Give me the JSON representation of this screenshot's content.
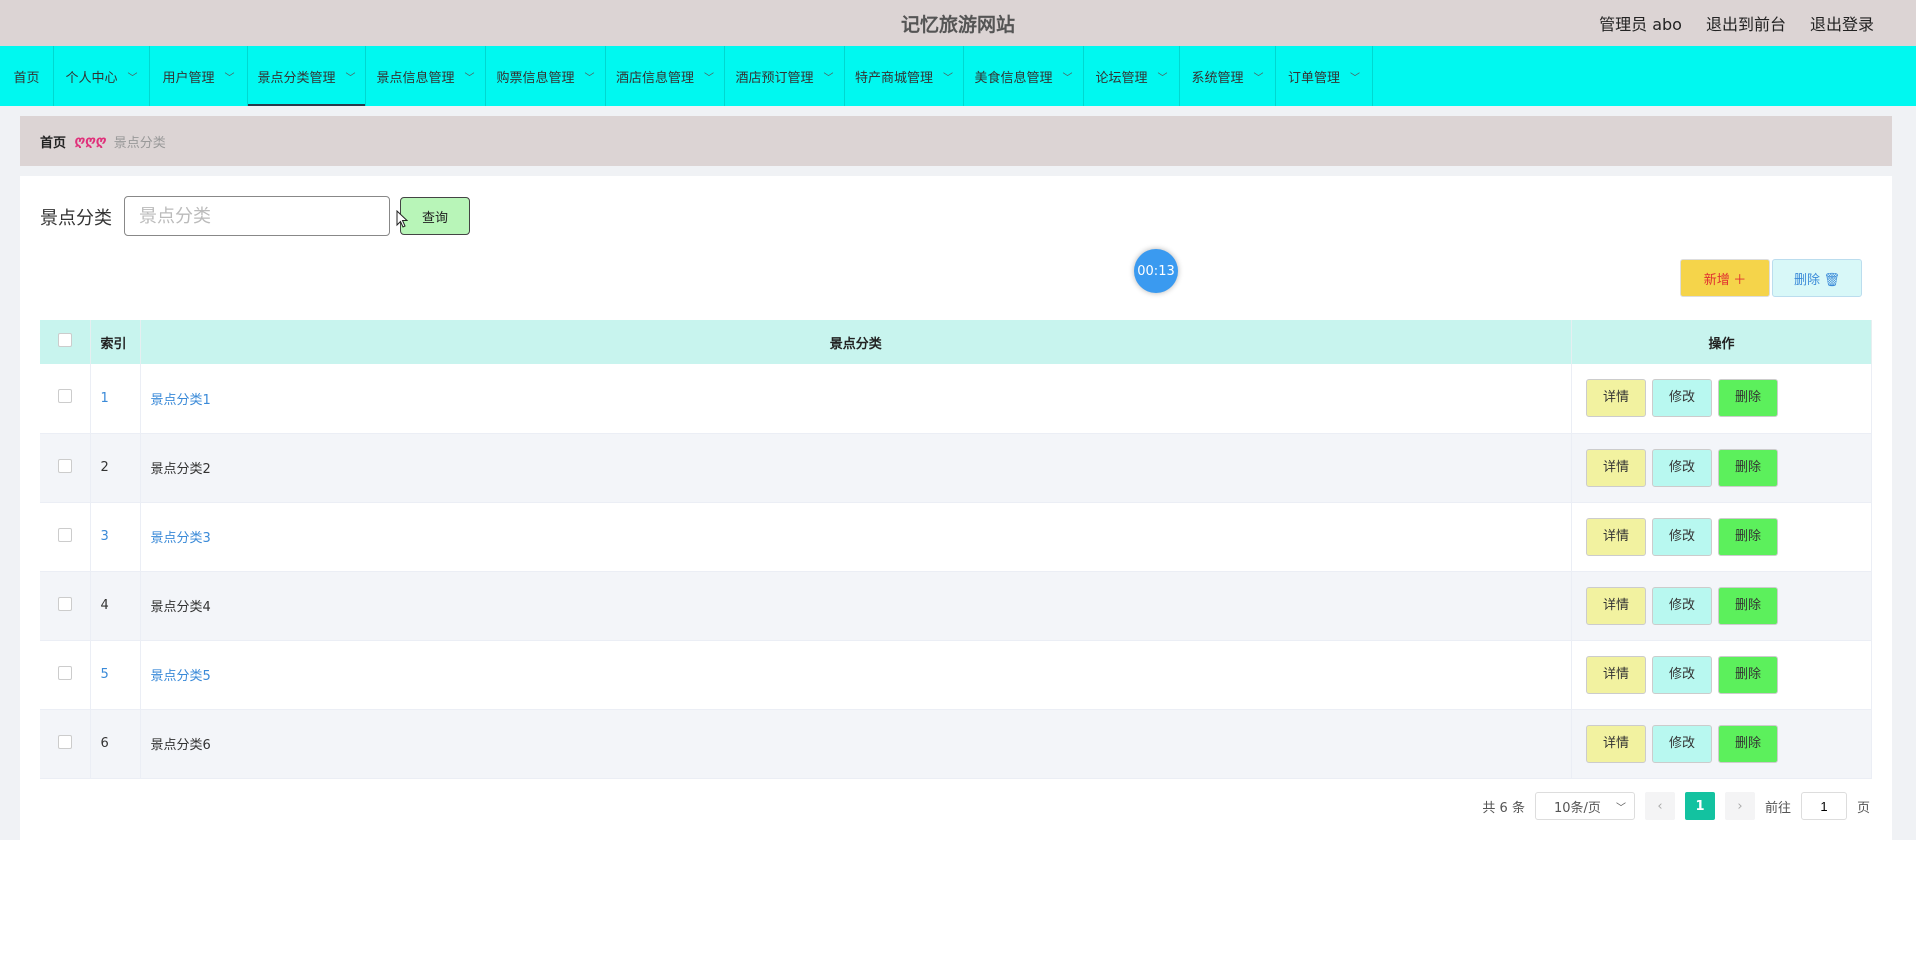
{
  "header": {
    "title": "记忆旅游网站",
    "user_label": "管理员 abo",
    "back_to_front": "退出到前台",
    "logout": "退出登录"
  },
  "nav": {
    "items": [
      {
        "label": "首页",
        "has_dropdown": false
      },
      {
        "label": "个人中心",
        "has_dropdown": true
      },
      {
        "label": "用户管理",
        "has_dropdown": true
      },
      {
        "label": "景点分类管理",
        "has_dropdown": true,
        "active": true
      },
      {
        "label": "景点信息管理",
        "has_dropdown": true
      },
      {
        "label": "购票信息管理",
        "has_dropdown": true
      },
      {
        "label": "酒店信息管理",
        "has_dropdown": true
      },
      {
        "label": "酒店预订管理",
        "has_dropdown": true
      },
      {
        "label": "特产商城管理",
        "has_dropdown": true
      },
      {
        "label": "美食信息管理",
        "has_dropdown": true
      },
      {
        "label": "论坛管理",
        "has_dropdown": true
      },
      {
        "label": "系统管理",
        "has_dropdown": true
      },
      {
        "label": "订单管理",
        "has_dropdown": true
      }
    ]
  },
  "breadcrumb": {
    "home": "首页",
    "separator": "ღღღ",
    "current": "景点分类"
  },
  "search": {
    "label": "景点分类",
    "placeholder": "景点分类",
    "button": "查询"
  },
  "timer": "00:13",
  "actions": {
    "add": "新增 ＋",
    "delete": "删除 🗑"
  },
  "table": {
    "headers": {
      "index": "索引",
      "category": "景点分类",
      "ops": "操作"
    },
    "rows": [
      {
        "index": "1",
        "category": "景点分类1"
      },
      {
        "index": "2",
        "category": "景点分类2"
      },
      {
        "index": "3",
        "category": "景点分类3"
      },
      {
        "index": "4",
        "category": "景点分类4"
      },
      {
        "index": "5",
        "category": "景点分类5"
      },
      {
        "index": "6",
        "category": "景点分类6"
      }
    ],
    "op_labels": {
      "detail": "详情",
      "edit": "修改",
      "delete": "删除"
    }
  },
  "pagination": {
    "total": "共 6 条",
    "page_size": "10条/页",
    "current_page": "1",
    "goto_prefix": "前往",
    "goto_value": "1",
    "goto_suffix": "页"
  }
}
